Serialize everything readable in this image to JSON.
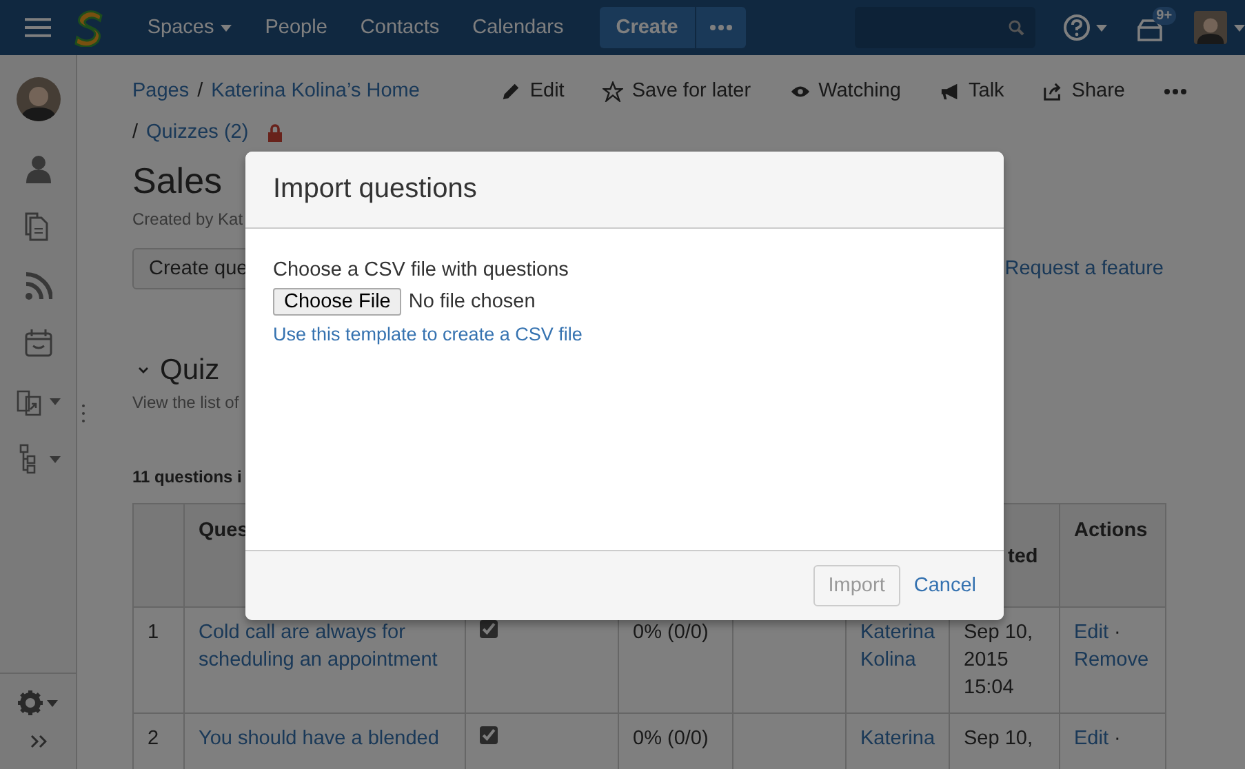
{
  "nav": {
    "items": [
      {
        "label": "Spaces",
        "dropdown": true
      },
      {
        "label": "People",
        "dropdown": false
      },
      {
        "label": "Contacts",
        "dropdown": false
      },
      {
        "label": "Calendars",
        "dropdown": false
      }
    ],
    "create": "Create",
    "notifications": "9+"
  },
  "breadcrumbs": [
    "Pages",
    "Katerina Kolina’s Home"
  ],
  "separator": "/",
  "sub_breadcrumb": "Quizzes (2)",
  "page_actions": [
    {
      "kind": "edit",
      "label": "Edit"
    },
    {
      "kind": "save",
      "label": "Save for later"
    },
    {
      "kind": "watch",
      "label": "Watching"
    },
    {
      "kind": "talk",
      "label": "Talk"
    },
    {
      "kind": "share",
      "label": "Share"
    }
  ],
  "page": {
    "title": "Sales",
    "byline": "Created by Kat",
    "create_button": "Create que",
    "feature_link": "Request a feature",
    "section_title": "Quiz",
    "section_text": "View the list of",
    "count": "11 questions i"
  },
  "table": {
    "columns": [
      {},
      {
        "label": "Ques"
      },
      {},
      {},
      {},
      {},
      {
        "label": "ted"
      },
      {
        "label": "Actions"
      }
    ],
    "action_separator": "·",
    "rows": [
      {
        "number": "1",
        "question": "Cold call are always for scheduling an appointment",
        "checked": true,
        "score": "0% (0/0)",
        "author": "Katerina Kolina",
        "created": "Sep 10, 2015 15:04",
        "actions": [
          "Edit",
          "Remove"
        ]
      },
      {
        "number": "2",
        "question": "You should have a blended",
        "checked": true,
        "score": "0% (0/0)",
        "author": "Katerina",
        "created": "Sep 10,",
        "actions": [
          "Edit"
        ]
      }
    ]
  },
  "dialog": {
    "title": "Import questions",
    "label": "Choose a CSV file with questions",
    "file_button": "Choose File",
    "file_status": "No file chosen",
    "template_link": "Use this template to create a CSV file",
    "buttons": [
      {
        "label": "Import",
        "kind": "button",
        "disabled": true
      },
      {
        "label": "Cancel",
        "kind": "link",
        "disabled": false
      }
    ]
  }
}
